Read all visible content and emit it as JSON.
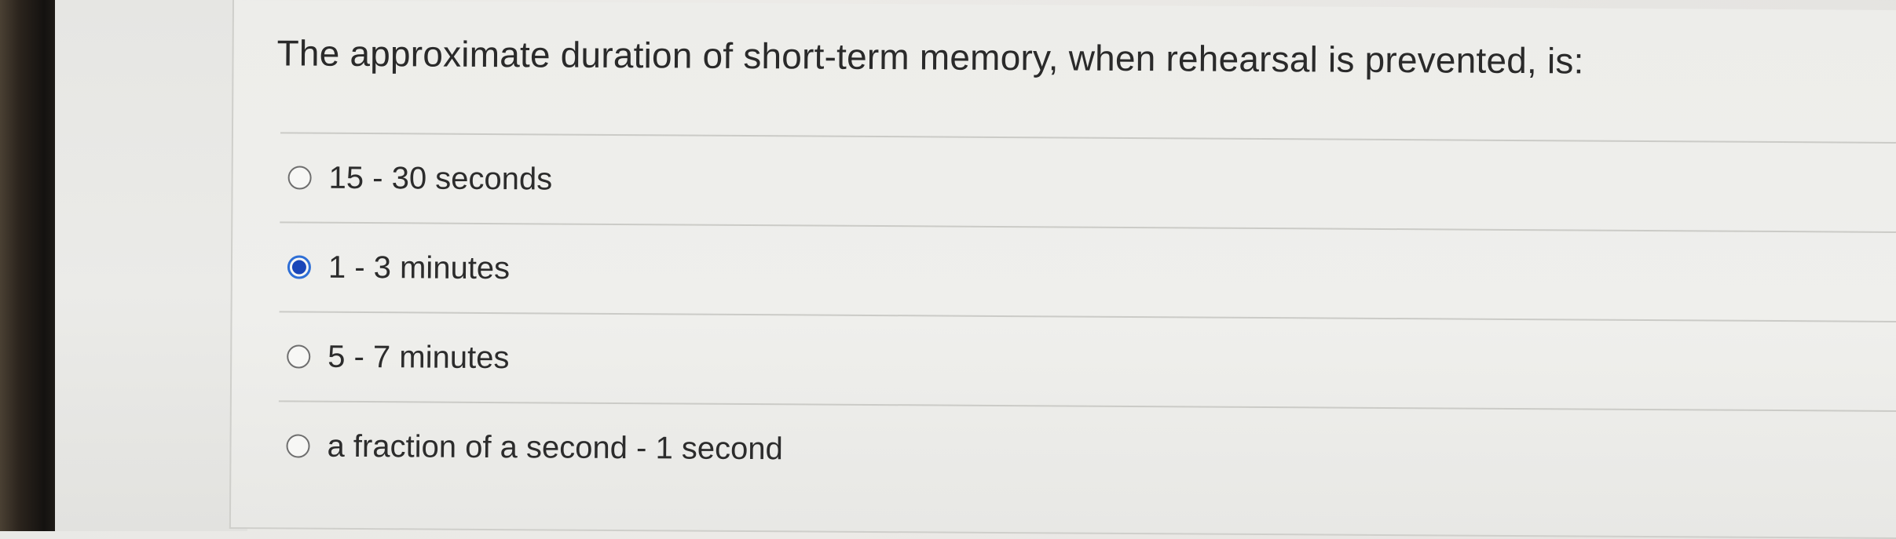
{
  "question": {
    "text": "The approximate duration of short-term memory, when rehearsal is prevented, is:"
  },
  "options": [
    {
      "label": "15 - 30 seconds",
      "selected": false
    },
    {
      "label": "1 - 3 minutes",
      "selected": true
    },
    {
      "label": "5 - 7 minutes",
      "selected": false
    },
    {
      "label": "a fraction of a second - 1 second",
      "selected": false
    }
  ],
  "colors": {
    "selected_radio": "#1a46b8",
    "selected_ring": "#2f6fd6",
    "text": "#2c2c2c",
    "divider": "#cbcbc7"
  }
}
